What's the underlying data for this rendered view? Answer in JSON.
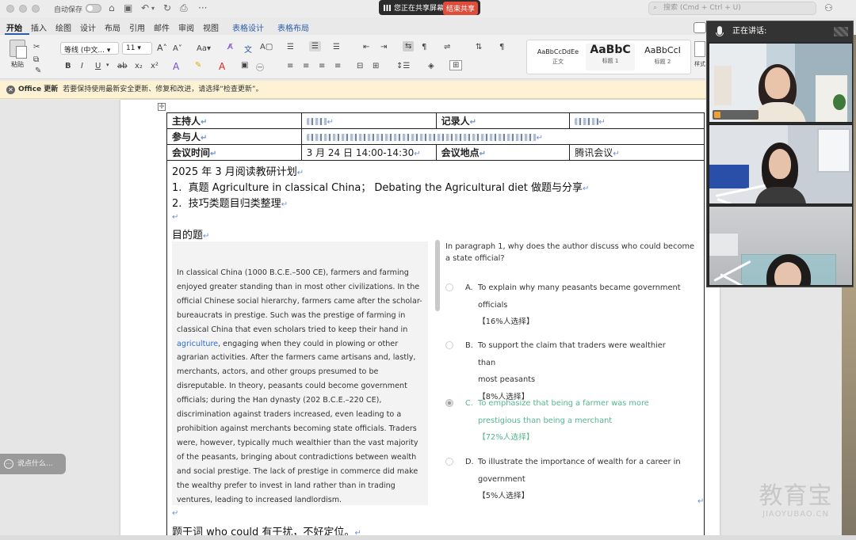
{
  "titlebar": {
    "autosave_label": "自动保存",
    "share_status": "您正在共享屏幕",
    "end_share": "结束共享",
    "search_placeholder": "搜索 (Cmd + Ctrl + U)"
  },
  "tabs": [
    {
      "label": "开始",
      "active": true
    },
    {
      "label": "插入"
    },
    {
      "label": "绘图"
    },
    {
      "label": "设计"
    },
    {
      "label": "布局"
    },
    {
      "label": "引用"
    },
    {
      "label": "邮件"
    },
    {
      "label": "审阅"
    },
    {
      "label": "视图"
    },
    {
      "label": "表格设计",
      "accent": true
    },
    {
      "label": "表格布局",
      "accent": true
    }
  ],
  "ribbon": {
    "paste_label": "粘贴",
    "font_name": "等线 (中文...",
    "font_size": "11",
    "styles": [
      {
        "sample": "AaBbCcDdEe",
        "name": "正文"
      },
      {
        "sample": "AaBbC",
        "name": "标题 1"
      },
      {
        "sample": "AaBbCcI",
        "name": "标题 2"
      }
    ],
    "more_styles": "样式窗格"
  },
  "update_bar": {
    "title": "Office 更新",
    "message": "若要保持使用最新安全更新、修复和改进，请选择“检查更新”。"
  },
  "meta_table": {
    "host_label": "主持人",
    "recorder_label": "记录人",
    "participants_label": "参与人",
    "time_label": "会议时间",
    "time_value": "3 月 24 日  14:00-14:30",
    "place_label": "会议地点",
    "place_value": "腾讯会议"
  },
  "doc": {
    "plan_title": "2025 年 3 月阅读教研计划",
    "item1_num": "1.",
    "item1": "真题 Agriculture in classical China；  Debating the Agricultural diet 做题与分享",
    "item2_num": "2.",
    "item2": "技巧类题目归类整理",
    "section_title": "目的题",
    "footer_note": "题干词 who could 有干扰，不好定位。"
  },
  "passage": {
    "part1": "In classical China (1000 B.C.E.–500 CE), farmers and farming enjoyed greater standing than in most other civilizations. In the official Chinese social hierarchy, farmers came after the scholar-bureaucrats in prestige. Such was the prestige of farming in classical China that even scholars tried to keep their hand in",
    "highlight": "agriculture",
    "part2": ", engaging when they could in plowing or other agrarian activities. After the farmers came artisans and, lastly, merchants, actors, and other groups presumed to be disreputable. In theory, peasants could become government officials; during the Han dynasty (202 B.C.E.–220 CE), discrimination against traders increased, even leading to a prohibition against merchants becoming state officials. Traders were, however, typically much wealthier than the vast majority of the peasants, bringing about contradictions between wealth and social prestige. The lack of prestige in commerce did make the wealthy prefer to invest in land rather than in trading ventures, leading to increased landlordism."
  },
  "question": {
    "prompt": "In paragraph 1, why does the author discuss who could become a state official?",
    "options": [
      {
        "letter": "A.",
        "line1": "To explain why many peasants became government",
        "line2": "officials",
        "stat": "【16%人选择】"
      },
      {
        "letter": "B.",
        "line1": "To support the claim that traders were wealthier than",
        "line2": "most peasants",
        "stat": "【8%人选择】"
      },
      {
        "letter": "C.",
        "line1": "To emphasize that being a farmer was more",
        "line2": "prestigious than being a merchant",
        "stat": "【72%人选择】"
      },
      {
        "letter": "D.",
        "line1": "To illustrate the importance of wealth for a career in",
        "line2": "government",
        "stat": "【5%人选择】"
      }
    ]
  },
  "video_panel": {
    "speaking_label": "正在讲话:"
  },
  "chat": {
    "placeholder": "说点什么..."
  },
  "watermark": {
    "cn": "教育宝",
    "en": "JIAOYUBAO.CN"
  },
  "colors": {
    "accent": "#2a5ca8",
    "correct_option": "#55b58e",
    "highlight_link": "#2c6ed6",
    "end_share": "#e04b3a",
    "update_bar": "#fdf3d4"
  }
}
